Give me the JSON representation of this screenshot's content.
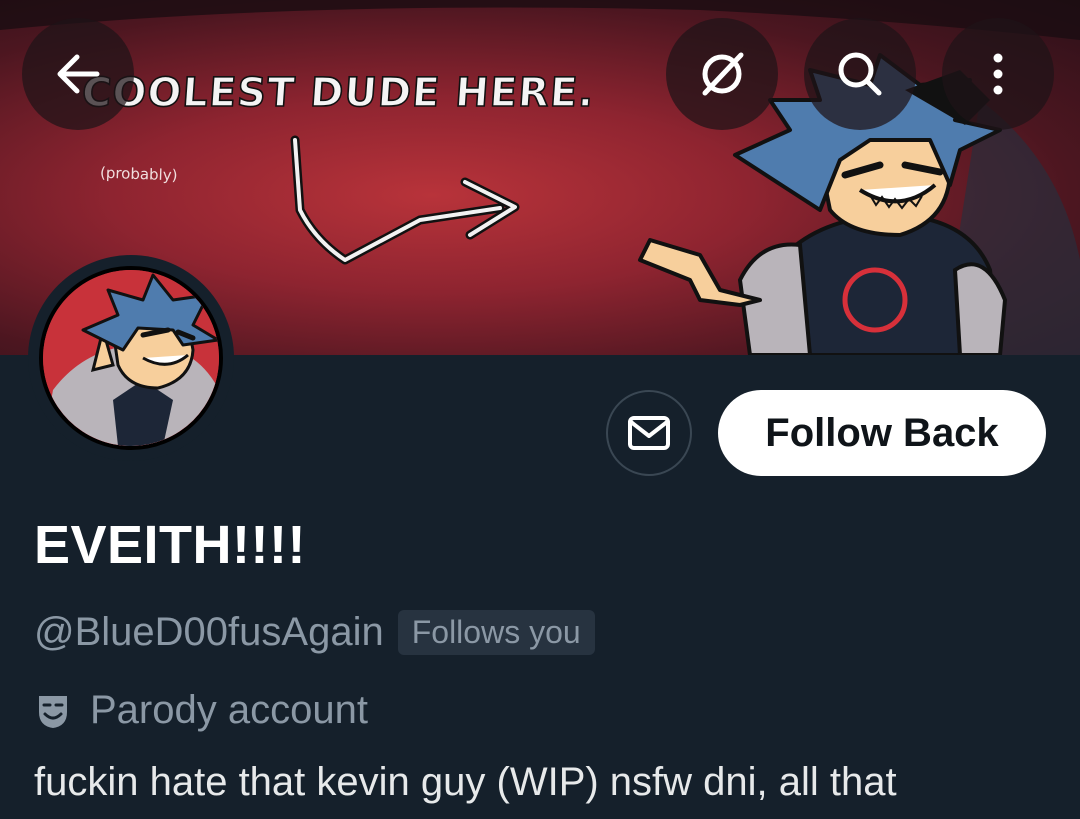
{
  "banner": {
    "headline": "COOLEST DUDE HERE.",
    "subtext": "(probably)"
  },
  "top_bar": {
    "back_icon": "arrow-left-icon",
    "grok_icon": "grok-icon",
    "search_icon": "search-icon",
    "more_icon": "more-vertical-icon"
  },
  "actions": {
    "message_icon": "envelope-icon",
    "follow_label": "Follow Back"
  },
  "profile": {
    "display_name": "EVEITH!!!!",
    "handle": "@BlueD00fusAgain",
    "follows_you": "Follows you",
    "parody_label": "Parody account",
    "bio": "fuckin hate that kevin guy (WIP) nsfw dni, all that"
  },
  "colors": {
    "background": "#15202b",
    "muted_text": "#8b98a5",
    "follow_button_bg": "#ffffff"
  }
}
